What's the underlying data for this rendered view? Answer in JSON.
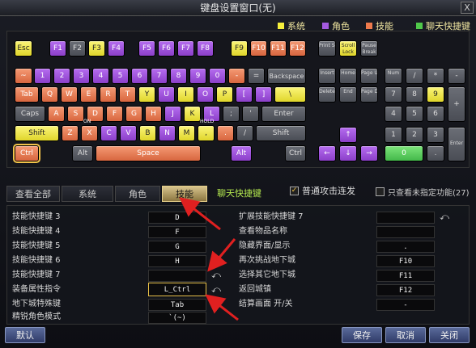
{
  "window": {
    "title": "键盘设置窗口(无)",
    "close_glyph": "X"
  },
  "legend": [
    {
      "label": "系统",
      "color": "#f5ef3c"
    },
    {
      "label": "角色",
      "color": "#a45be0"
    },
    {
      "label": "技能",
      "color": "#ee7a4c"
    },
    {
      "label": "聊天快捷键",
      "color": "#4fc84a"
    }
  ],
  "keyboard": {
    "fn_row": [
      "Esc",
      "F1",
      "F2",
      "F3",
      "F4",
      "F5",
      "F6",
      "F7",
      "F8",
      "F9",
      "F10",
      "F11",
      "F12"
    ],
    "sys_keys": [
      "Print Screen",
      "Scroll Lock",
      "Pause Break"
    ],
    "num_row": [
      "~",
      "1",
      "2",
      "3",
      "4",
      "5",
      "6",
      "7",
      "8",
      "9",
      "0",
      "-",
      "=",
      "Backspace"
    ],
    "q_row": [
      "Tab",
      "Q",
      "W",
      "E",
      "R",
      "T",
      "Y",
      "U",
      "I",
      "O",
      "P",
      "[",
      "]",
      "\\"
    ],
    "a_row": [
      "Caps",
      "A",
      "S",
      "D",
      "F",
      "G",
      "H",
      "J",
      "K",
      "L",
      ";",
      "'",
      "Enter"
    ],
    "z_row": [
      "Shift",
      "Z",
      "X",
      "C",
      "V",
      "B",
      "N",
      "M",
      ",",
      ".",
      "/",
      "Shift"
    ],
    "bottom_row": [
      "Ctrl",
      "Alt",
      "Space",
      "Alt",
      "Ctrl"
    ],
    "nav_top": [
      "Insert",
      "Home",
      "Page Up"
    ],
    "nav_bottom": [
      "Delete",
      "End",
      "Page Down"
    ],
    "arrows": [
      "↑",
      "←",
      "↓",
      "→"
    ],
    "numpad": [
      "Num",
      "/",
      "*",
      "-",
      "7",
      "8",
      "9",
      "4",
      "5",
      "6",
      "+",
      "1",
      "2",
      "3",
      "0",
      ".",
      "Enter"
    ],
    "x_badge": "ON",
    "m_badge": "HOLD"
  },
  "tabs": [
    "查看全部",
    "系统",
    "角色",
    "技能",
    "聊天快捷键"
  ],
  "options": {
    "basic_attack": {
      "label": "普通攻击连发",
      "checked": true,
      "check": "✓"
    },
    "unassigned": {
      "label": "只查看未指定功能(27)",
      "checked": false
    }
  },
  "left_rows": [
    {
      "label": "技能快捷键 3",
      "value": "D"
    },
    {
      "label": "技能快捷键 4",
      "value": "F"
    },
    {
      "label": "技能快捷键 5",
      "value": "G"
    },
    {
      "label": "技能快捷键 6",
      "value": "H"
    },
    {
      "label": "技能快捷键 7",
      "value": ""
    },
    {
      "label": "装备属性指令",
      "value": "L_Ctrl"
    },
    {
      "label": "地下城特殊键",
      "value": "Tab"
    },
    {
      "label": "精锐角色模式",
      "value": "`(~)"
    }
  ],
  "right_rows": [
    {
      "label": "扩展技能快捷键 7",
      "value": ""
    },
    {
      "label": "查看物品名称",
      "value": ""
    },
    {
      "label": "隐藏界面/显示",
      "value": "."
    },
    {
      "label": "再次挑战地下城",
      "value": "F10"
    },
    {
      "label": "选择其它地下城",
      "value": "F11"
    },
    {
      "label": "返回城镇",
      "value": "F12"
    },
    {
      "label": "结算画面 开/关",
      "value": "-"
    }
  ],
  "reset_glyph": "⤺",
  "buttons": {
    "default": "默认",
    "save": "保存",
    "cancel": "取消",
    "close": "关闭"
  }
}
